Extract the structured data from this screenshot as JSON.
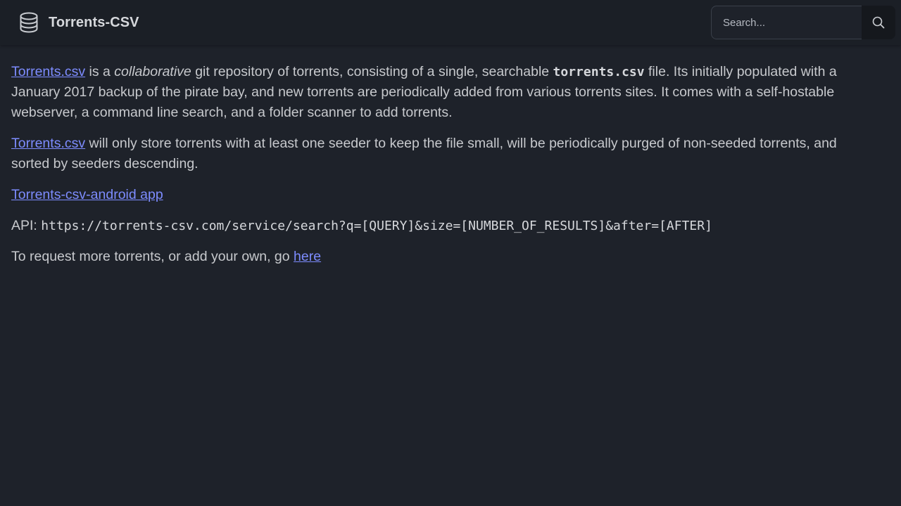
{
  "header": {
    "brand": "Torrents-CSV",
    "search_placeholder": "Search..."
  },
  "icons": {
    "brand": "database-icon",
    "search": "search-icon"
  },
  "intro": {
    "link": "Torrents.csv",
    "t1": " is a ",
    "em": "collaborative",
    "t2": " git repository of torrents, consisting of a single, searchable ",
    "code": "torrents.csv",
    "t3": " file. Its initially populated with a January 2017 backup of the pirate bay, and new torrents are periodically added from various torrents sites. It comes with a self-hostable webserver, a command line search, and a folder scanner to add torrents."
  },
  "storage": {
    "link": "Torrents.csv",
    "text": " will only store torrents with at least one seeder to keep the file small, will be periodically purged of non-seeded torrents, and sorted by seeders descending."
  },
  "android": {
    "link": "Torrents-csv-android app"
  },
  "api": {
    "label": "API: ",
    "url": "https://torrents-csv.com/service/search?q=[QUERY]&size=[NUMBER_OF_RESULTS]&after=[AFTER]"
  },
  "request": {
    "text": "To request more torrents, or add your own, go ",
    "link": "here"
  },
  "colors": {
    "background": "#1e222a",
    "navbar": "#1b1f26",
    "link": "#7d8cff",
    "text": "#c7c9cd"
  }
}
